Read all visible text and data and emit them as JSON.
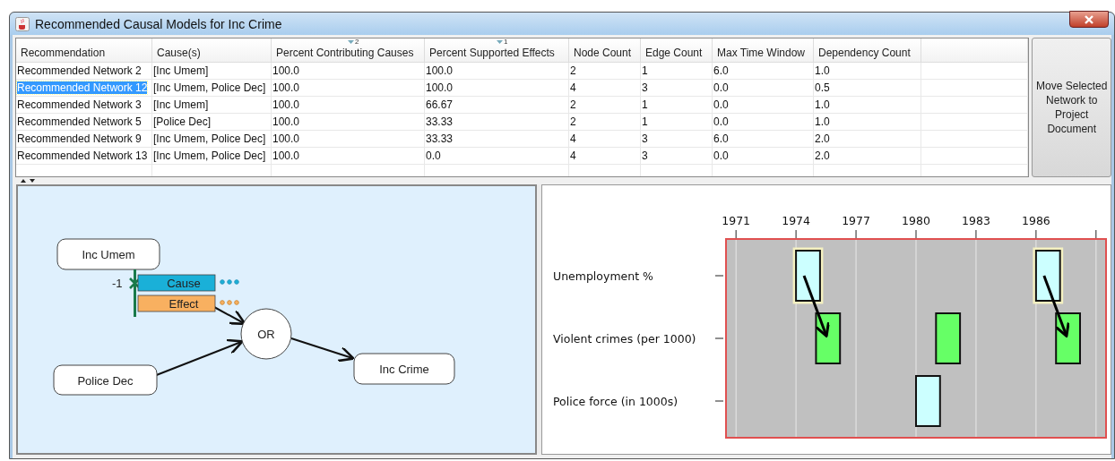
{
  "window": {
    "title": "Recommended Causal Models for Inc Crime"
  },
  "table": {
    "columns": [
      {
        "label": "Recommendation"
      },
      {
        "label": "Cause(s)"
      },
      {
        "label": "Percent Contributing Causes",
        "sort_rank": "2"
      },
      {
        "label": "Percent Supported Effects",
        "sort_rank": "1"
      },
      {
        "label": "Node Count"
      },
      {
        "label": "Edge Count"
      },
      {
        "label": "Max Time Window"
      },
      {
        "label": "Dependency Count"
      }
    ],
    "rows": [
      {
        "selected": false,
        "cells": [
          "Recommended Network 2",
          "[Inc Umem]",
          "100.0",
          "100.0",
          "2",
          "1",
          "6.0",
          "1.0"
        ]
      },
      {
        "selected": true,
        "cells": [
          "Recommended Network 12",
          "[Inc Umem, Police Dec]",
          "100.0",
          "100.0",
          "4",
          "3",
          "0.0",
          "0.5"
        ]
      },
      {
        "selected": false,
        "cells": [
          "Recommended Network 3",
          "[Inc Umem]",
          "100.0",
          "66.67",
          "2",
          "1",
          "0.0",
          "1.0"
        ]
      },
      {
        "selected": false,
        "cells": [
          "Recommended Network 5",
          "[Police Dec]",
          "100.0",
          "33.33",
          "2",
          "1",
          "0.0",
          "1.0"
        ]
      },
      {
        "selected": false,
        "cells": [
          "Recommended Network 9",
          "[Inc Umem, Police Dec]",
          "100.0",
          "33.33",
          "4",
          "3",
          "6.0",
          "2.0"
        ]
      },
      {
        "selected": false,
        "cells": [
          "Recommended Network 13",
          "[Inc Umem, Police Dec]",
          "100.0",
          "0.0",
          "4",
          "3",
          "0.0",
          "2.0"
        ]
      }
    ]
  },
  "move_button": {
    "label": "Move Selected Network to Project Document"
  },
  "diagram": {
    "nodes": [
      {
        "label": "Inc Umem",
        "kind": "box"
      },
      {
        "label": "Police Dec",
        "kind": "box"
      },
      {
        "label": "OR",
        "kind": "gate"
      },
      {
        "label": "Inc Crime",
        "kind": "box"
      }
    ],
    "relation": {
      "weight": "-1",
      "cause_label": "Cause",
      "effect_label": "Effect"
    }
  },
  "timeline": {
    "years": [
      "1971",
      "1974",
      "1977",
      "1980",
      "1983",
      "1986"
    ],
    "rows": [
      {
        "label": "Unemployment %",
        "color": "#ccffff",
        "bars": [
          {
            "selected": true,
            "arrow_down": true
          },
          {
            "selected": true,
            "arrow_down": true
          }
        ]
      },
      {
        "label": "Violent crimes (per 1000)",
        "color": "#66ff66",
        "bars": [
          {
            "selected": false,
            "arrow_down": false
          },
          {
            "selected": false,
            "arrow_down": false
          },
          {
            "selected": false,
            "arrow_down": false
          }
        ]
      },
      {
        "label": "Police force (in 1000s)",
        "color": "#ccffff",
        "bars": [
          {
            "selected": false,
            "arrow_down": false
          }
        ]
      }
    ]
  }
}
